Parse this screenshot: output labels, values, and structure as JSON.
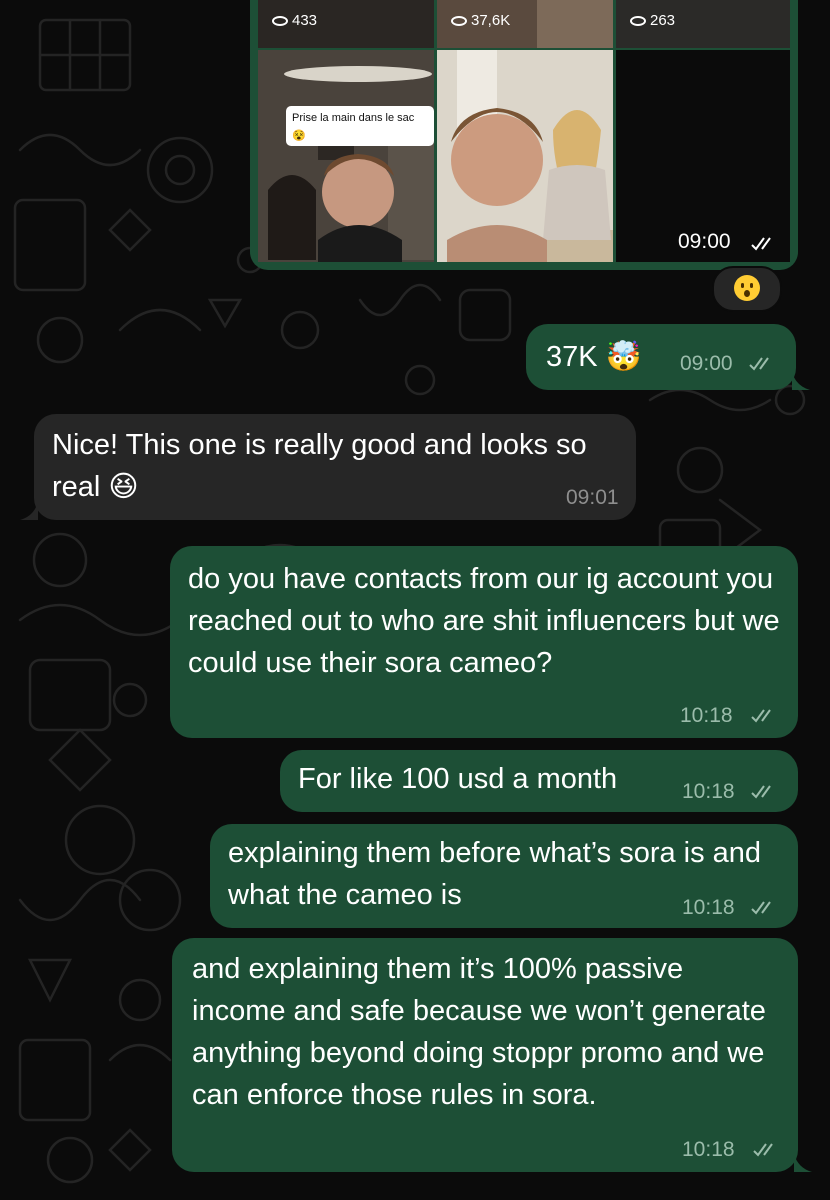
{
  "media": {
    "view_counts": [
      "433",
      "37,6K",
      "263"
    ],
    "overlay_caption": "Prise la main dans le sac 😵",
    "time": "09:00"
  },
  "reaction_emoji": "😮",
  "messages": [
    {
      "direction": "outgoing",
      "text": "37K 🤯",
      "time": "09:00"
    },
    {
      "direction": "incoming",
      "text": "Nice! This one is really good and looks so real 😆",
      "time": "09:01"
    },
    {
      "direction": "outgoing",
      "text": "do you have contacts from our ig account you reached out to who are shit influencers but we could use their sora cameo?",
      "time": "10:18"
    },
    {
      "direction": "outgoing",
      "text": "For like 100 usd a month",
      "time": "10:18"
    },
    {
      "direction": "outgoing",
      "text": "explaining them before what’s sora is and what the cameo is",
      "time": "10:18"
    },
    {
      "direction": "outgoing",
      "text": "and explaining them it’s 100% passive income and safe because we won’t generate anything beyond doing stoppr promo and we can enforce those rules in sora.",
      "time": "10:18"
    }
  ],
  "colors": {
    "background": "#0b0b0b",
    "outgoing_bubble": "#1d4f36",
    "incoming_bubble": "#262626",
    "read_ticks": "#9bbcab"
  },
  "icons": [
    "views-eye-icon",
    "read-receipt-double-check-icon"
  ]
}
